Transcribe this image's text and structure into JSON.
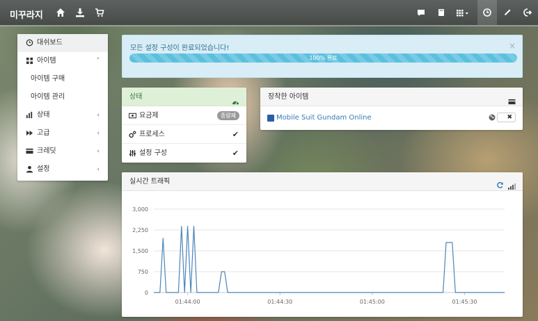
{
  "navbar": {
    "brand": "미꾸라지",
    "left_icons": [
      "home-icon",
      "download-icon",
      "cart-icon"
    ],
    "right_icons": [
      "chat-icon",
      "book-icon",
      "grid-icon",
      "clock-icon",
      "pencil-icon",
      "logout-icon"
    ]
  },
  "sidebar": {
    "items": [
      {
        "label": "대쉬보드",
        "icon": "dashboard-icon"
      },
      {
        "label": "아이템",
        "icon": "items-icon"
      },
      {
        "label": "아이템 구매"
      },
      {
        "label": "아이템 관리"
      },
      {
        "label": "상태",
        "icon": "bar-chart-icon"
      },
      {
        "label": "고급",
        "icon": "fast-forward-icon"
      },
      {
        "label": "크레딧",
        "icon": "credit-card-icon"
      },
      {
        "label": "설정",
        "icon": "user-icon"
      }
    ],
    "expanded_chevron": "˅",
    "collapsed_chevron": "‹"
  },
  "alert": {
    "message": "모든 설정 구성이 완료되었습니다!",
    "close": "×",
    "progress_label": "100% 완료",
    "progress_value": 1.0
  },
  "status_panel": {
    "title": "상태",
    "rows": [
      {
        "label": "요금제",
        "badge": "종량제"
      },
      {
        "label": "프로세스",
        "check": "✔"
      },
      {
        "label": "설정 구성",
        "check": "✔"
      }
    ]
  },
  "equipped_panel": {
    "title": "장착한 아이템",
    "item_name": "Mobile Suit Gundam Online",
    "toggle_label": "✖"
  },
  "traffic_panel": {
    "title": "실시간 트래픽"
  },
  "colors": {
    "accent": "#337ab7",
    "line": "#4a84b8",
    "alert_bg": "#d9edf7",
    "progress": "#5bc0de",
    "success_bg": "#dff0d8"
  },
  "chart_data": {
    "type": "line",
    "title": "",
    "xlabel": "",
    "ylabel": "",
    "ylim": [
      0,
      3000
    ],
    "yticks": [
      0,
      750,
      1500,
      2250,
      3000
    ],
    "ytick_labels": [
      "0",
      "750",
      "1,500",
      "2,250",
      "3,000"
    ],
    "xlim": [
      "01:43:49",
      "01:45:43"
    ],
    "xticks": [
      "01:44:00",
      "01:44:30",
      "01:45:00",
      "01:45:30"
    ],
    "grid": true,
    "series": [
      {
        "x": [
          "01:43:49",
          "01:43:51",
          "01:43:52",
          "01:43:53",
          "01:43:57",
          "01:43:58",
          "01:43:59",
          "01:44:00",
          "01:44:01",
          "01:44:02",
          "01:44:03",
          "01:44:04",
          "01:44:05",
          "01:44:10",
          "01:44:11",
          "01:44:12",
          "01:44:13",
          "01:45:23",
          "01:45:24",
          "01:45:25",
          "01:45:26",
          "01:45:27",
          "01:45:43"
        ],
        "y": [
          0,
          0,
          1950,
          0,
          0,
          2380,
          0,
          2380,
          0,
          2380,
          0,
          0,
          0,
          0,
          750,
          750,
          0,
          0,
          1800,
          1800,
          1800,
          0,
          0
        ]
      }
    ]
  }
}
